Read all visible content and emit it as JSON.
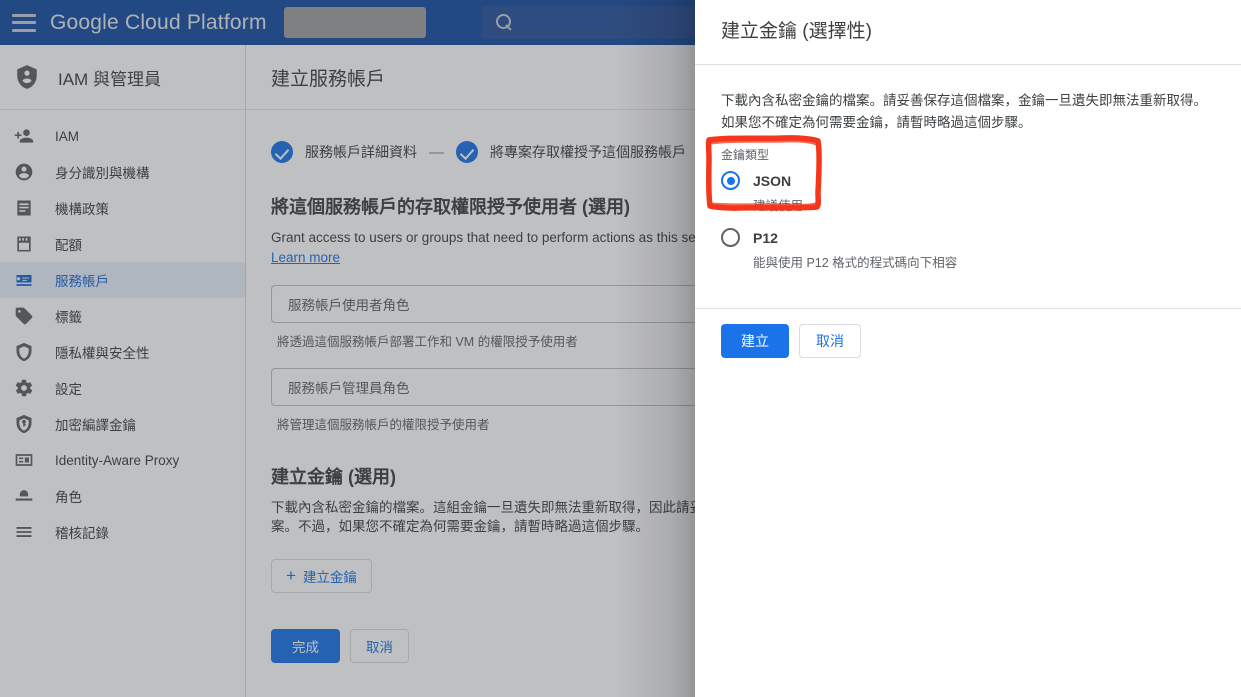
{
  "topbar": {
    "menu_icon": "hamburger-icon",
    "brand": "Google Cloud Platform",
    "project_selector": "",
    "search_icon": "search-icon",
    "search_placeholder": ""
  },
  "sidebar": {
    "header": {
      "icon": "shield-person-icon",
      "title": "IAM 與管理員"
    },
    "items": [
      {
        "icon": "person-add-icon",
        "label": "IAM"
      },
      {
        "icon": "account-circle-icon",
        "label": "身分識別與機構"
      },
      {
        "icon": "policy-document-icon",
        "label": "機構政策"
      },
      {
        "icon": "quota-icon",
        "label": "配額"
      },
      {
        "icon": "service-account-icon",
        "label": "服務帳戶",
        "active": true
      },
      {
        "icon": "label-tag-icon",
        "label": "標籤"
      },
      {
        "icon": "shield-lock-icon",
        "label": "隱私權與安全性"
      },
      {
        "icon": "gear-icon",
        "label": "設定"
      },
      {
        "icon": "key-shield-icon",
        "label": "加密編譯金鑰"
      },
      {
        "icon": "proxy-icon",
        "label": "Identity-Aware Proxy"
      },
      {
        "icon": "roles-icon",
        "label": "角色"
      },
      {
        "icon": "list-log-icon",
        "label": "稽核記錄"
      }
    ]
  },
  "main": {
    "page_title": "建立服務帳戶",
    "steps": [
      {
        "label": "服務帳戶詳細資料",
        "done": true
      },
      {
        "label": "將專案存取權授予這個服務帳戶",
        "done": true
      }
    ],
    "step_separator": "—",
    "grant_section": {
      "heading": "將這個服務帳戶的存取權限授予使用者 (選用)",
      "description": "Grant access to users or groups that need to perform actions as this servi",
      "learn_more": "Learn more",
      "fields": [
        {
          "placeholder": "服務帳戶使用者角色",
          "help": "將透過這個服務帳戶部署工作和 VM 的權限授予使用者"
        },
        {
          "placeholder": "服務帳戶管理員角色",
          "help": "將管理這個服務帳戶的權限授予使用者"
        }
      ]
    },
    "key_section": {
      "heading": "建立金鑰 (選用)",
      "description_line1": "下載內含私密金鑰的檔案。這組金鑰一旦遺失即無法重新取得，因此請妥善",
      "description_line2": "案。不過，如果您不確定為何需要金鑰，請暫時略過這個步驟。",
      "create_key_plus": "+",
      "create_key_label": "建立金鑰"
    },
    "footer": {
      "done_label": "完成",
      "cancel_label": "取消"
    }
  },
  "dialog": {
    "title": "建立金鑰 (選擇性)",
    "description": "下載內含私密金鑰的檔案。請妥善保存這個檔案，金鑰一旦遺失即無法重新取得。如果您不確定為何需要金鑰，請暫時略過這個步驟。",
    "key_type_label": "金鑰類型",
    "options": [
      {
        "value": "JSON",
        "label": "JSON",
        "sub": "建議使用",
        "selected": true
      },
      {
        "value": "P12",
        "label": "P12",
        "sub": "能與使用 P12 格式的程式碼向下相容",
        "selected": false
      }
    ],
    "create_label": "建立",
    "cancel_label": "取消"
  },
  "annotation": {
    "shape": "red-highlight-rectangle",
    "color": "#f4361c"
  },
  "colors": {
    "brand_blue": "#174ea6",
    "accent_blue": "#1a73e8",
    "active_nav_bg": "#e8f0fe",
    "annotation_red": "#f4361c"
  }
}
